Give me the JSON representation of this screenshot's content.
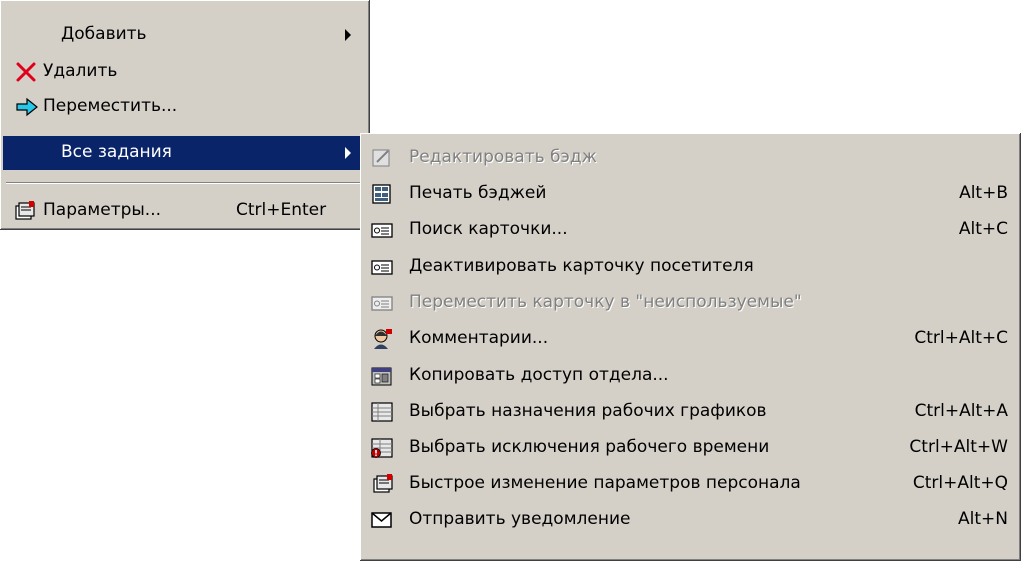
{
  "main_menu": {
    "items": [
      {
        "label": "Добавить",
        "icon": "none",
        "submenu": true
      },
      {
        "label": "Удалить",
        "icon": "delete-x-icon",
        "icon_color": "#e0001a"
      },
      {
        "label": "Переместить...",
        "icon": "move-arrow-icon",
        "icon_color": "#29c7e8"
      },
      {
        "label": "Все задания",
        "icon": "none",
        "submenu": true,
        "highlighted": true
      },
      {
        "label": "Параметры...",
        "icon": "properties-icon",
        "shortcut": "Ctrl+Enter"
      }
    ]
  },
  "submenu": {
    "items": [
      {
        "label": "Редактировать бэдж",
        "icon": "edit-badge-icon",
        "shortcut": "",
        "disabled": true
      },
      {
        "label": "Печать бэджей",
        "icon": "print-badges-icon",
        "shortcut": "Alt+B"
      },
      {
        "label": "Поиск карточки...",
        "icon": "card-icon",
        "shortcut": "Alt+C"
      },
      {
        "label": "Деактивировать карточку посетителя",
        "icon": "card-icon",
        "shortcut": ""
      },
      {
        "label": "Переместить карточку в \"неиспользуемые\"",
        "icon": "card-icon",
        "shortcut": "",
        "disabled": true
      },
      {
        "label": "Комментарии...",
        "icon": "person-comment-icon",
        "shortcut": "Ctrl+Alt+C"
      },
      {
        "label": "Копировать доступ отдела...",
        "icon": "copy-access-icon",
        "shortcut": ""
      },
      {
        "label": "Выбрать назначения рабочих графиков",
        "icon": "schedule-grid-icon",
        "shortcut": "Ctrl+Alt+A"
      },
      {
        "label": "Выбрать исключения рабочего времени",
        "icon": "schedule-exception-icon",
        "shortcut": "Ctrl+Alt+W"
      },
      {
        "label": "Быстрое изменение параметров персонала",
        "icon": "properties-icon",
        "shortcut": "Ctrl+Alt+Q"
      },
      {
        "label": "Отправить уведомление",
        "icon": "envelope-icon",
        "shortcut": "Alt+N"
      }
    ]
  },
  "colors": {
    "menu_bg": "#d4d0c8",
    "highlight_bg": "#0a246a",
    "disabled_text": "#808080"
  }
}
